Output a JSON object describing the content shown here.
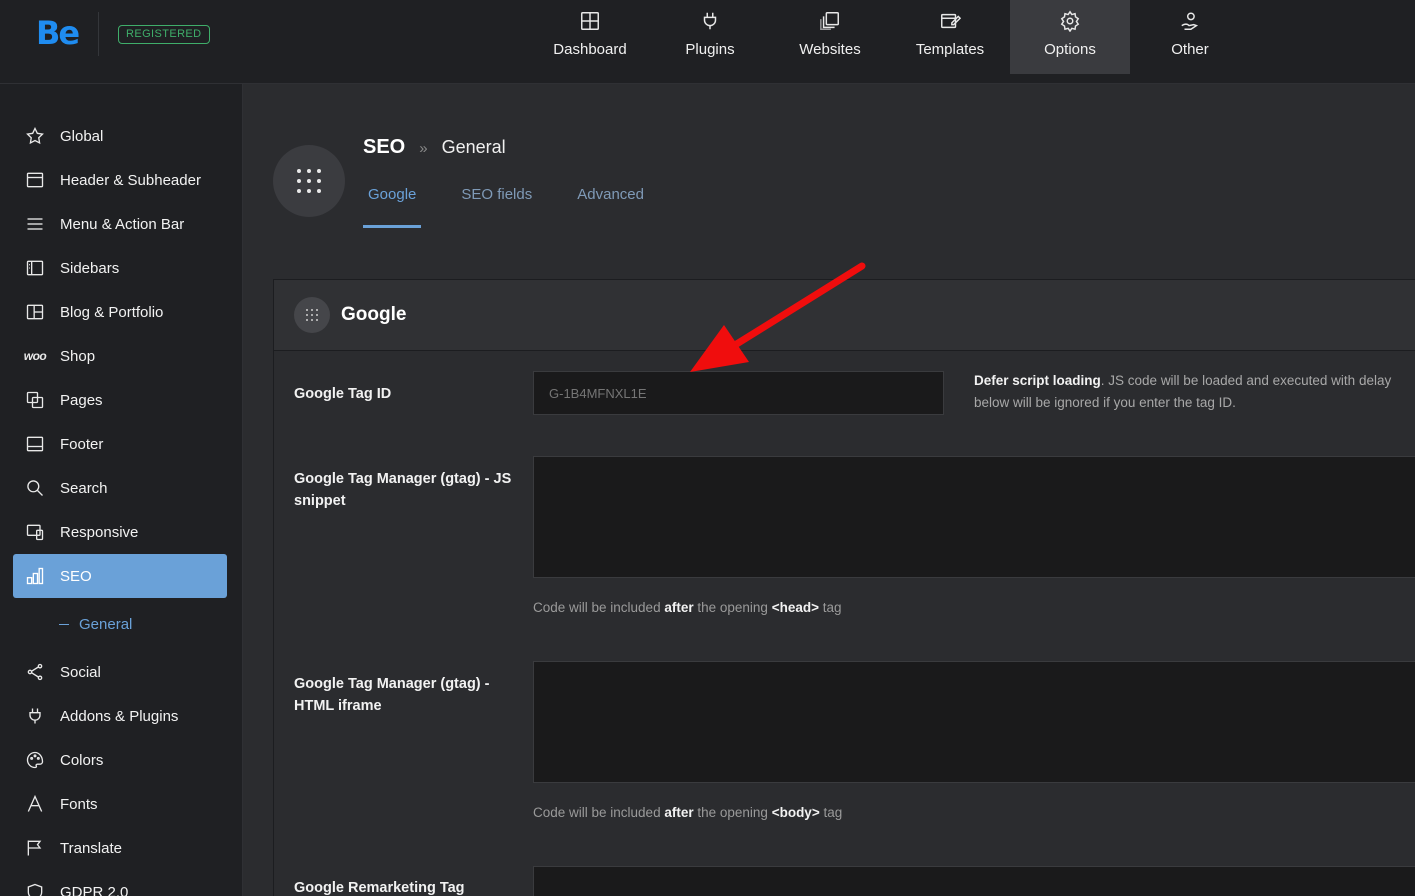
{
  "brand": {
    "logo_text": "Be",
    "badge": "REGISTERED",
    "accent": "#1f8cf0",
    "badge_color": "#3fae6a"
  },
  "topnav": [
    {
      "label": "Dashboard",
      "icon": "dashboard-icon"
    },
    {
      "label": "Plugins",
      "icon": "plug-icon"
    },
    {
      "label": "Websites",
      "icon": "websites-icon"
    },
    {
      "label": "Templates",
      "icon": "templates-icon"
    },
    {
      "label": "Options",
      "icon": "gear-icon",
      "active": true
    },
    {
      "label": "Other",
      "icon": "other-icon"
    }
  ],
  "sidebar": {
    "items": [
      {
        "label": "Global",
        "icon": "star-icon"
      },
      {
        "label": "Header & Subheader",
        "icon": "header-icon"
      },
      {
        "label": "Menu & Action Bar",
        "icon": "menu-icon"
      },
      {
        "label": "Sidebars",
        "icon": "sidebars-icon"
      },
      {
        "label": "Blog & Portfolio",
        "icon": "blog-icon"
      },
      {
        "label": "Shop",
        "icon": "woo-icon",
        "icon_text": "woo"
      },
      {
        "label": "Pages",
        "icon": "pages-icon"
      },
      {
        "label": "Footer",
        "icon": "footer-icon"
      },
      {
        "label": "Search",
        "icon": "search-icon"
      },
      {
        "label": "Responsive",
        "icon": "responsive-icon"
      },
      {
        "label": "SEO",
        "icon": "seo-chart-icon",
        "active": true
      },
      {
        "label": "General",
        "sub": true
      },
      {
        "label": "Social",
        "icon": "share-icon"
      },
      {
        "label": "Addons & Plugins",
        "icon": "plug-icon"
      },
      {
        "label": "Colors",
        "icon": "palette-icon"
      },
      {
        "label": "Fonts",
        "icon": "font-icon"
      },
      {
        "label": "Translate",
        "icon": "flag-icon"
      },
      {
        "label": "GDPR 2.0",
        "icon": "gdpr-icon"
      }
    ],
    "active_color": "#6aa1d8"
  },
  "header": {
    "section": "SEO",
    "separator": "»",
    "page": "General",
    "tabs": [
      {
        "label": "Google",
        "active": true
      },
      {
        "label": "SEO fields"
      },
      {
        "label": "Advanced"
      }
    ]
  },
  "panel": {
    "title": "Google",
    "fields": {
      "tag_id": {
        "label": "Google Tag ID",
        "placeholder": "G-1B4MFNXL1E",
        "desc_strong": "Defer script loading",
        "desc_rest": ". JS code will be loaded and executed with delay",
        "desc_line2": "below will be ignored if you enter the tag ID."
      },
      "gtag_js": {
        "label": "Google Tag Manager (gtag) - JS snippet",
        "help_pre": "Code will be included ",
        "help_strong": "after",
        "help_mid": " the opening ",
        "help_tag": "<head>",
        "help_post": " tag"
      },
      "gtag_iframe": {
        "label": "Google Tag Manager (gtag) - HTML iframe",
        "help_pre": "Code will be included ",
        "help_strong": "after",
        "help_mid": " the opening ",
        "help_tag": "<body>",
        "help_post": " tag"
      },
      "remarketing": {
        "label": "Google Remarketing Tag"
      }
    }
  },
  "annotation": {
    "arrow_color": "#f00d0d"
  }
}
